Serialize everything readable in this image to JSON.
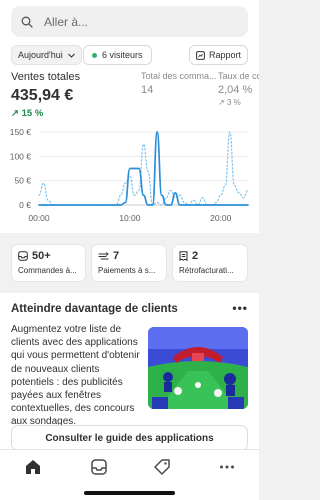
{
  "search": {
    "placeholder": "Aller à..."
  },
  "filters": {
    "date_label": "Aujourd'hui",
    "visitors_label": "6 visiteurs",
    "report_label": "Rapport"
  },
  "metrics": {
    "total_sales": {
      "label": "Ventes totales",
      "value": "435,94 €",
      "change": "15 %"
    },
    "total_orders": {
      "label": "Total des comma...",
      "value": "14"
    },
    "conversion": {
      "label": "Taux de co",
      "value": "2,04 %",
      "change": "3 %"
    }
  },
  "chart_data": {
    "type": "line",
    "y_ticks": [
      "150 €",
      "100 €",
      "50 €",
      "0 €"
    ],
    "x_ticks": [
      "00:00",
      "10:00",
      "20:00"
    ],
    "ylim": [
      0,
      150
    ],
    "series": [
      {
        "style": "solid",
        "color": "#2b8fd6",
        "x": [
          0,
          0.5,
          1,
          1.5,
          2,
          2.5,
          3,
          3.5,
          4,
          4.5,
          5,
          5.5,
          6,
          6.5,
          7,
          7.5,
          8,
          8.5,
          9,
          9.5,
          10,
          10.5,
          11,
          11.5,
          12,
          12.5,
          13,
          13.5,
          14,
          14.5,
          15,
          15.5,
          16,
          16.5,
          17,
          17.5,
          18,
          18.5,
          19,
          19.5,
          20,
          20.5,
          21,
          21.5,
          22,
          22.5,
          23
        ],
        "y": [
          0,
          0,
          0,
          0,
          0,
          0,
          0,
          0,
          0,
          0,
          0,
          0,
          0,
          0,
          0,
          0,
          0,
          0,
          0,
          5,
          75,
          75,
          75,
          20,
          0,
          0,
          150,
          20,
          0,
          0,
          25,
          0,
          0,
          0,
          0,
          0,
          0,
          0,
          0,
          0,
          0,
          0,
          0,
          0,
          0,
          0,
          0
        ]
      },
      {
        "style": "dotted",
        "color": "#7fc3ee",
        "x": [
          0,
          0.5,
          1,
          1.5,
          2,
          2.5,
          3,
          3.5,
          4,
          4.5,
          5,
          5.5,
          6,
          6.5,
          7,
          7.5,
          8,
          8.5,
          9,
          9.5,
          10,
          10.5,
          11,
          11.5,
          12,
          12.5,
          13,
          13.5,
          14,
          14.5,
          15,
          15.5,
          16,
          16.5,
          17,
          17.5,
          18,
          18.5,
          19,
          19.5,
          20,
          20.5,
          21,
          21.5,
          22,
          22.5,
          23
        ],
        "y": [
          20,
          45,
          10,
          0,
          0,
          0,
          0,
          0,
          0,
          0,
          0,
          0,
          0,
          0,
          0,
          0,
          0,
          0,
          20,
          45,
          60,
          20,
          30,
          125,
          70,
          0,
          5,
          0,
          15,
          30,
          15,
          20,
          5,
          0,
          10,
          0,
          15,
          0,
          0,
          5,
          20,
          40,
          150,
          40,
          25,
          15,
          30
        ]
      }
    ]
  },
  "actions": [
    {
      "count": "50+",
      "label": "Commandes à..."
    },
    {
      "count": "7",
      "label": "Paiements à s..."
    },
    {
      "count": "2",
      "label": "Rétrofacturati..."
    }
  ],
  "promo": {
    "title": "Atteindre davantage de clients",
    "body": "Augmentez votre liste de clients avec des applications qui vous permettent d'obtenir de nouveaux clients potentiels : des publicités payées aux fenêtres contextuelles, des concours aux sondages.",
    "cta": "Consulter le guide des applications"
  },
  "tabbar": {
    "icons": [
      "home-icon",
      "inbox-icon",
      "tag-icon",
      "more-icon"
    ]
  },
  "colors": {
    "accent_green": "#1e8a4c",
    "line_blue": "#2b8fd6",
    "line_dotted": "#7fc3ee"
  }
}
